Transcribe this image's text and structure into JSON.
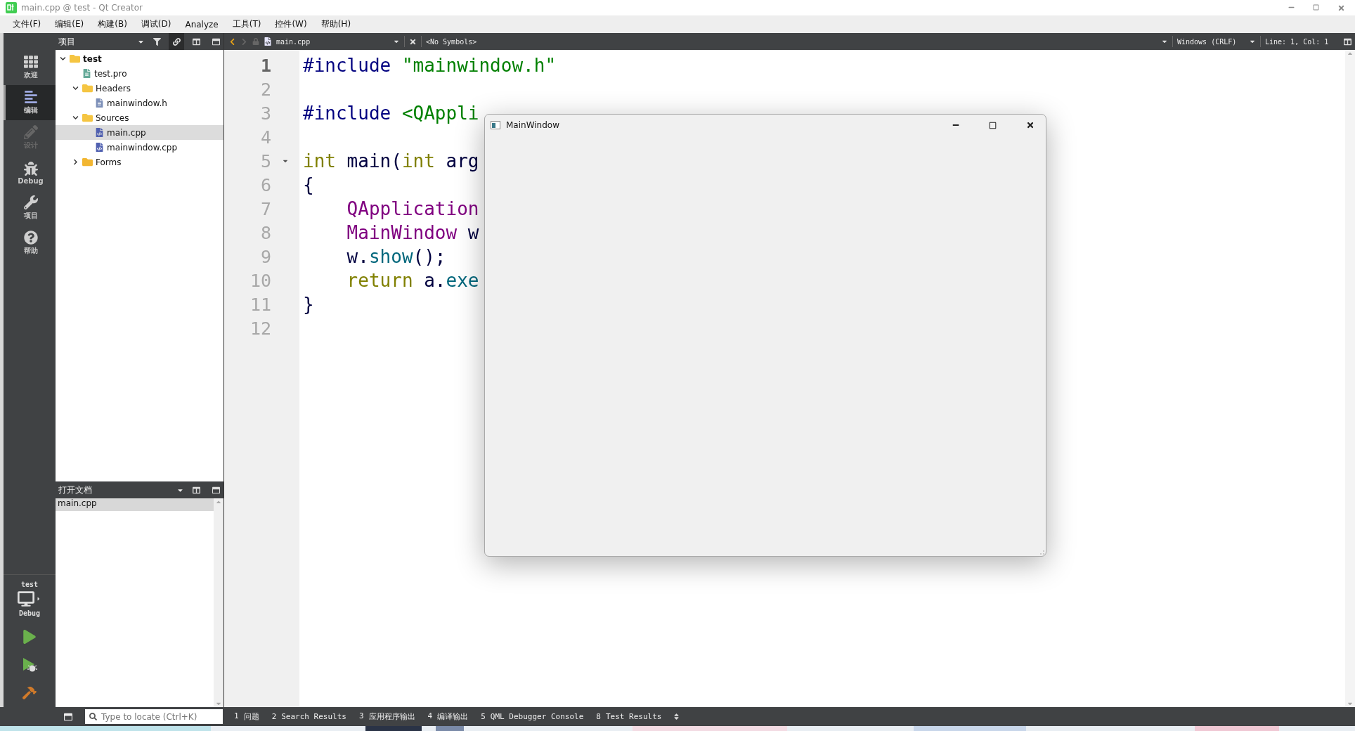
{
  "window": {
    "title": "main.cpp @ test - Qt Creator"
  },
  "menu": [
    "文件(F)",
    "编辑(E)",
    "构建(B)",
    "调试(D)",
    "Analyze",
    "工具(T)",
    "控件(W)",
    "帮助(H)"
  ],
  "modes": [
    {
      "label": "欢迎",
      "selected": false,
      "disabled": false
    },
    {
      "label": "编辑",
      "selected": true,
      "disabled": false
    },
    {
      "label": "设计",
      "selected": false,
      "disabled": true
    },
    {
      "label": "Debug",
      "selected": false,
      "disabled": false
    },
    {
      "label": "项目",
      "selected": false,
      "disabled": false
    },
    {
      "label": "帮助",
      "selected": false,
      "disabled": false
    }
  ],
  "kit": {
    "project": "test",
    "build": "Debug"
  },
  "project_panel": {
    "title": "项目"
  },
  "tree": [
    {
      "label": "test",
      "kind": "project",
      "expanded": true,
      "selected": false,
      "children": [
        {
          "label": "test.pro",
          "kind": "pro",
          "selected": false
        },
        {
          "label": "Headers",
          "kind": "headers",
          "expanded": true,
          "selected": false,
          "children": [
            {
              "label": "mainwindow.h",
              "kind": "header",
              "selected": false
            }
          ]
        },
        {
          "label": "Sources",
          "kind": "sources",
          "expanded": true,
          "selected": false,
          "children": [
            {
              "label": "main.cpp",
              "kind": "source",
              "selected": true
            },
            {
              "label": "mainwindow.cpp",
              "kind": "source",
              "selected": false
            }
          ]
        },
        {
          "label": "Forms",
          "kind": "forms",
          "expanded": false,
          "selected": false
        }
      ]
    }
  ],
  "editor_toolbar": {
    "file": "main.cpp",
    "symbols": "<No Symbols>",
    "line_ending": "Windows (CRLF)",
    "position": "Line: 1, Col: 1"
  },
  "code": [
    {
      "number": "1",
      "current": true,
      "foldable": false,
      "tokens": [
        {
          "text": "#include",
          "kind": "preproc"
        },
        {
          "text": " \"mainwindow.h\"",
          "kind": "string"
        }
      ]
    },
    {
      "number": "2",
      "current": false,
      "foldable": false
    },
    {
      "number": "3",
      "current": false,
      "foldable": false,
      "tokens": [
        {
          "text": "#include",
          "kind": "preproc"
        },
        {
          "text": " <QAppli",
          "kind": "string"
        }
      ]
    },
    {
      "number": "4",
      "current": false,
      "foldable": false
    },
    {
      "number": "5",
      "current": false,
      "foldable": true,
      "tokens": [
        {
          "text": "int",
          "kind": "keyword"
        },
        {
          "text": " main(",
          "kind": "plain"
        },
        {
          "text": "int",
          "kind": "keyword"
        },
        {
          "text": " arg",
          "kind": "plain"
        }
      ]
    },
    {
      "number": "6",
      "current": false,
      "foldable": false,
      "tokens": [
        {
          "text": "{",
          "kind": "plain"
        }
      ]
    },
    {
      "number": "7",
      "current": false,
      "foldable": false,
      "tokens": [
        {
          "text": "    QApplication",
          "kind": "type"
        }
      ]
    },
    {
      "number": "8",
      "current": false,
      "foldable": false,
      "tokens": [
        {
          "text": "    MainWindow",
          "kind": "type"
        },
        {
          "text": " w",
          "kind": "plain"
        }
      ]
    },
    {
      "number": "9",
      "current": false,
      "foldable": false,
      "tokens": [
        {
          "text": "    w.",
          "kind": "plain"
        },
        {
          "text": "show",
          "kind": "func"
        },
        {
          "text": "();",
          "kind": "plain"
        }
      ]
    },
    {
      "number": "10",
      "current": false,
      "foldable": false,
      "tokens": [
        {
          "text": "    return",
          "kind": "keyword"
        },
        {
          "text": " a.",
          "kind": "plain"
        },
        {
          "text": "exe",
          "kind": "func"
        }
      ]
    },
    {
      "number": "11",
      "current": false,
      "foldable": false,
      "tokens": [
        {
          "text": "}",
          "kind": "plain"
        }
      ]
    },
    {
      "number": "12",
      "current": false,
      "foldable": false
    }
  ],
  "open_documents": {
    "title": "打开文档",
    "items": [
      {
        "label": "main.cpp",
        "selected": true
      }
    ]
  },
  "locator": {
    "placeholder": "Type to locate (Ctrl+K)"
  },
  "output_tabs": [
    {
      "number": "1",
      "label": "问题"
    },
    {
      "number": "2",
      "label": "Search Results"
    },
    {
      "number": "3",
      "label": "应用程序输出"
    },
    {
      "number": "4",
      "label": "编译输出"
    },
    {
      "number": "5",
      "label": "QML Debugger Console"
    },
    {
      "number": "8",
      "label": "Test Results"
    }
  ],
  "app_window": {
    "title": "MainWindow"
  }
}
